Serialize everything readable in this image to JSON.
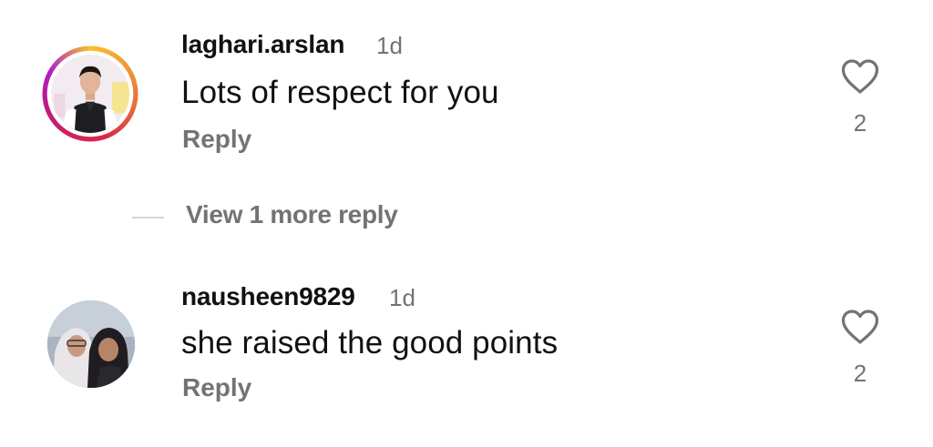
{
  "comments": [
    {
      "username": "laghari.arslan",
      "time": "1d",
      "text": "Lots of respect for you",
      "reply_label": "Reply",
      "like_count": "2",
      "avatar_ring_color": "#dc2743"
    },
    {
      "username": "nausheen9829",
      "time": "1d",
      "text": "she raised the good points",
      "reply_label": "Reply",
      "like_count": "2"
    }
  ],
  "view_replies": {
    "label": "View 1 more reply"
  },
  "icons": {
    "like": "heart-outline-icon"
  },
  "colors": {
    "text_primary": "#111111",
    "text_secondary": "#737373"
  }
}
